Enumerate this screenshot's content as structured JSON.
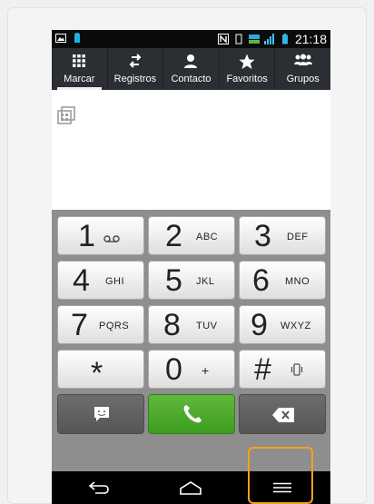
{
  "status_bar": {
    "time": "21:18"
  },
  "tabs": [
    {
      "label": "Marcar",
      "icon": "dialpad-icon",
      "active": true
    },
    {
      "label": "Registros",
      "icon": "arrows-swap-icon",
      "active": false
    },
    {
      "label": "Contacto",
      "icon": "person-icon",
      "active": false
    },
    {
      "label": "Favoritos",
      "icon": "star-icon",
      "active": false
    },
    {
      "label": "Grupos",
      "icon": "group-icon",
      "active": false
    }
  ],
  "keypad": {
    "keys": [
      {
        "digit": "1",
        "letters": "",
        "icon": "voicemail-icon"
      },
      {
        "digit": "2",
        "letters": "ABC"
      },
      {
        "digit": "3",
        "letters": "DEF"
      },
      {
        "digit": "4",
        "letters": "GHI"
      },
      {
        "digit": "5",
        "letters": "JKL"
      },
      {
        "digit": "6",
        "letters": "MNO"
      },
      {
        "digit": "7",
        "letters": "PQRS"
      },
      {
        "digit": "8",
        "letters": "TUV"
      },
      {
        "digit": "9",
        "letters": "WXYZ"
      },
      {
        "digit": "*",
        "letters": ""
      },
      {
        "digit": "0",
        "letters": "+"
      },
      {
        "digit": "#",
        "letters": "",
        "icon": "vibrate-icon"
      }
    ],
    "bottom_row": {
      "message_icon": "message-icon",
      "call_icon": "phone-call-icon",
      "backspace_icon": "backspace-icon"
    }
  },
  "navbar": {
    "back_icon": "back-icon",
    "home_icon": "home-icon",
    "menu_icon": "menu-icon"
  },
  "colors": {
    "highlight": "#f4a21a",
    "call_green": "#4aa82a",
    "tab_bg": "#2b2e33"
  }
}
